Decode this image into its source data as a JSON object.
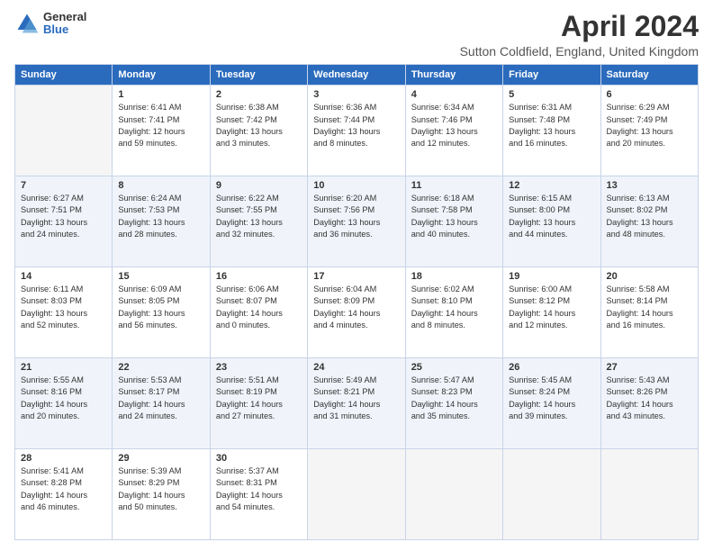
{
  "logo": {
    "general": "General",
    "blue": "Blue"
  },
  "title": "April 2024",
  "subtitle": "Sutton Coldfield, England, United Kingdom",
  "days_header": [
    "Sunday",
    "Monday",
    "Tuesday",
    "Wednesday",
    "Thursday",
    "Friday",
    "Saturday"
  ],
  "weeks": [
    [
      {
        "day": "",
        "info": ""
      },
      {
        "day": "1",
        "info": "Sunrise: 6:41 AM\nSunset: 7:41 PM\nDaylight: 12 hours\nand 59 minutes."
      },
      {
        "day": "2",
        "info": "Sunrise: 6:38 AM\nSunset: 7:42 PM\nDaylight: 13 hours\nand 3 minutes."
      },
      {
        "day": "3",
        "info": "Sunrise: 6:36 AM\nSunset: 7:44 PM\nDaylight: 13 hours\nand 8 minutes."
      },
      {
        "day": "4",
        "info": "Sunrise: 6:34 AM\nSunset: 7:46 PM\nDaylight: 13 hours\nand 12 minutes."
      },
      {
        "day": "5",
        "info": "Sunrise: 6:31 AM\nSunset: 7:48 PM\nDaylight: 13 hours\nand 16 minutes."
      },
      {
        "day": "6",
        "info": "Sunrise: 6:29 AM\nSunset: 7:49 PM\nDaylight: 13 hours\nand 20 minutes."
      }
    ],
    [
      {
        "day": "7",
        "info": "Sunrise: 6:27 AM\nSunset: 7:51 PM\nDaylight: 13 hours\nand 24 minutes."
      },
      {
        "day": "8",
        "info": "Sunrise: 6:24 AM\nSunset: 7:53 PM\nDaylight: 13 hours\nand 28 minutes."
      },
      {
        "day": "9",
        "info": "Sunrise: 6:22 AM\nSunset: 7:55 PM\nDaylight: 13 hours\nand 32 minutes."
      },
      {
        "day": "10",
        "info": "Sunrise: 6:20 AM\nSunset: 7:56 PM\nDaylight: 13 hours\nand 36 minutes."
      },
      {
        "day": "11",
        "info": "Sunrise: 6:18 AM\nSunset: 7:58 PM\nDaylight: 13 hours\nand 40 minutes."
      },
      {
        "day": "12",
        "info": "Sunrise: 6:15 AM\nSunset: 8:00 PM\nDaylight: 13 hours\nand 44 minutes."
      },
      {
        "day": "13",
        "info": "Sunrise: 6:13 AM\nSunset: 8:02 PM\nDaylight: 13 hours\nand 48 minutes."
      }
    ],
    [
      {
        "day": "14",
        "info": "Sunrise: 6:11 AM\nSunset: 8:03 PM\nDaylight: 13 hours\nand 52 minutes."
      },
      {
        "day": "15",
        "info": "Sunrise: 6:09 AM\nSunset: 8:05 PM\nDaylight: 13 hours\nand 56 minutes."
      },
      {
        "day": "16",
        "info": "Sunrise: 6:06 AM\nSunset: 8:07 PM\nDaylight: 14 hours\nand 0 minutes."
      },
      {
        "day": "17",
        "info": "Sunrise: 6:04 AM\nSunset: 8:09 PM\nDaylight: 14 hours\nand 4 minutes."
      },
      {
        "day": "18",
        "info": "Sunrise: 6:02 AM\nSunset: 8:10 PM\nDaylight: 14 hours\nand 8 minutes."
      },
      {
        "day": "19",
        "info": "Sunrise: 6:00 AM\nSunset: 8:12 PM\nDaylight: 14 hours\nand 12 minutes."
      },
      {
        "day": "20",
        "info": "Sunrise: 5:58 AM\nSunset: 8:14 PM\nDaylight: 14 hours\nand 16 minutes."
      }
    ],
    [
      {
        "day": "21",
        "info": "Sunrise: 5:55 AM\nSunset: 8:16 PM\nDaylight: 14 hours\nand 20 minutes."
      },
      {
        "day": "22",
        "info": "Sunrise: 5:53 AM\nSunset: 8:17 PM\nDaylight: 14 hours\nand 24 minutes."
      },
      {
        "day": "23",
        "info": "Sunrise: 5:51 AM\nSunset: 8:19 PM\nDaylight: 14 hours\nand 27 minutes."
      },
      {
        "day": "24",
        "info": "Sunrise: 5:49 AM\nSunset: 8:21 PM\nDaylight: 14 hours\nand 31 minutes."
      },
      {
        "day": "25",
        "info": "Sunrise: 5:47 AM\nSunset: 8:23 PM\nDaylight: 14 hours\nand 35 minutes."
      },
      {
        "day": "26",
        "info": "Sunrise: 5:45 AM\nSunset: 8:24 PM\nDaylight: 14 hours\nand 39 minutes."
      },
      {
        "day": "27",
        "info": "Sunrise: 5:43 AM\nSunset: 8:26 PM\nDaylight: 14 hours\nand 43 minutes."
      }
    ],
    [
      {
        "day": "28",
        "info": "Sunrise: 5:41 AM\nSunset: 8:28 PM\nDaylight: 14 hours\nand 46 minutes."
      },
      {
        "day": "29",
        "info": "Sunrise: 5:39 AM\nSunset: 8:29 PM\nDaylight: 14 hours\nand 50 minutes."
      },
      {
        "day": "30",
        "info": "Sunrise: 5:37 AM\nSunset: 8:31 PM\nDaylight: 14 hours\nand 54 minutes."
      },
      {
        "day": "",
        "info": ""
      },
      {
        "day": "",
        "info": ""
      },
      {
        "day": "",
        "info": ""
      },
      {
        "day": "",
        "info": ""
      }
    ]
  ]
}
